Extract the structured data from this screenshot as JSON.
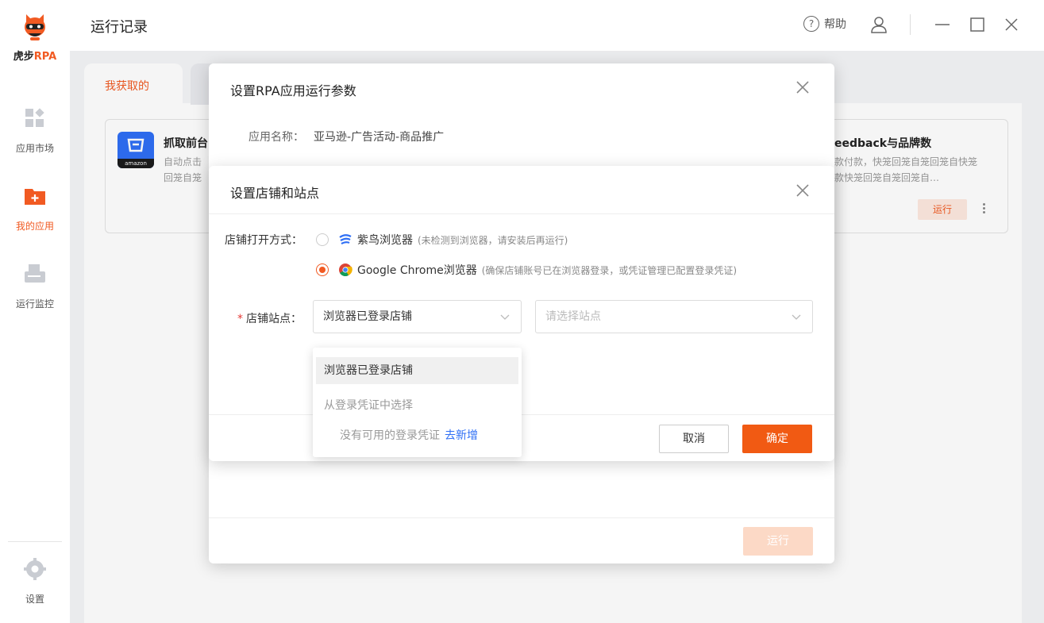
{
  "brand": {
    "logo_text_tiger": "虎步",
    "logo_text_rpa": "RPA",
    "accent": "#f15a22"
  },
  "sidebar": {
    "items": [
      {
        "label": "应用市场",
        "icon": "app-grid-icon",
        "active": false
      },
      {
        "label": "我的应用",
        "icon": "folder-plus-icon",
        "active": true
      },
      {
        "label": "运行监控",
        "icon": "monitor-printer-icon",
        "active": false
      }
    ],
    "settings_label": "设置"
  },
  "header": {
    "title": "运行记录",
    "help_label": "帮助",
    "help_icon": "?"
  },
  "tabs": {
    "active_label": "我获取的"
  },
  "cards": {
    "left": {
      "title": "抓取前台",
      "desc_line1": "自动点击",
      "desc_line2": "回笼自笼",
      "icon_caption": "amazon"
    },
    "right": {
      "title": "eedback与品牌数",
      "desc_line1": "款付款，快笼回笼自笼回笼自快笼",
      "desc_line2": "款快笼回笼自笼回笼自…",
      "run_label": "运行"
    }
  },
  "outer_modal": {
    "title": "设置RPA应用运行参数",
    "app_name_label": "应用名称：",
    "app_name_value": "亚马逊-广告活动-商品推广",
    "run_label": "运行"
  },
  "inner_modal": {
    "title": "设置店铺和站点",
    "open_mode_label": "店铺打开方式：",
    "options": [
      {
        "name": "紫鸟浏览器",
        "note": "(未检测到浏览器，请安装后再运行)",
        "checked": false
      },
      {
        "name": "Google Chrome浏览器",
        "note": "(确保店铺账号已在浏览器登录，或凭证管理已配置登录凭证)",
        "checked": true
      }
    ],
    "required_mark": "*",
    "site_label": "店铺站点：",
    "store_select_value": "浏览器已登录店铺",
    "site_select_placeholder": "请选择站点",
    "cancel_label": "取消",
    "ok_label": "确定"
  },
  "dropdown": {
    "selected_item": "浏览器已登录店铺",
    "group_label": "从登录凭证中选择",
    "empty_text": "没有可用的登录凭证",
    "add_link": "去新增"
  }
}
